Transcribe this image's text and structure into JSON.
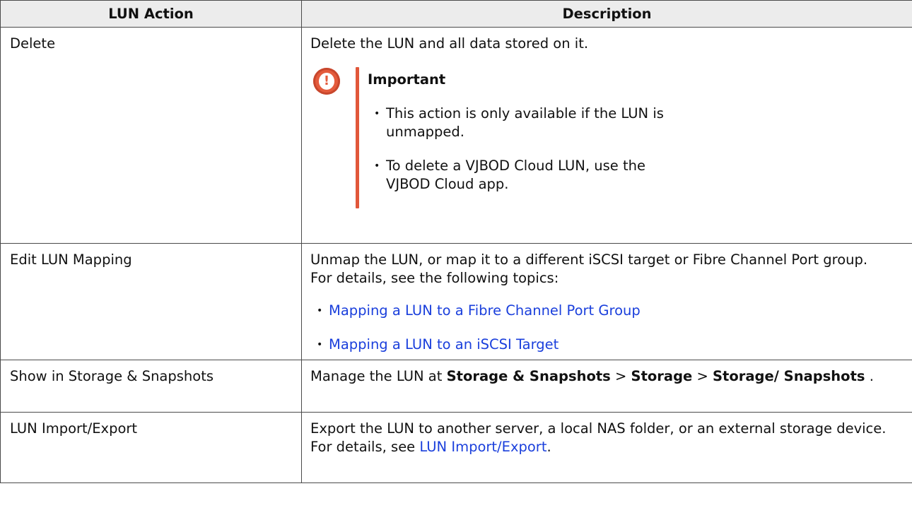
{
  "table": {
    "header": {
      "action": "LUN Action",
      "description": "Description"
    },
    "rows": [
      {
        "action": "Delete",
        "description": "Delete the LUN and all data stored on it.",
        "note": {
          "title": "Important",
          "icon": "alert-icon",
          "icon_glyph": "!",
          "color": "#e45b3c",
          "items": [
            "This action is only available if the LUN is unmapped.",
            "To delete a VJBOD Cloud LUN, use the VJBOD Cloud app."
          ]
        }
      },
      {
        "action": "Edit LUN Mapping",
        "line1": "Unmap the LUN, or map it to a different iSCSI target or Fibre Channel Port group.",
        "line2": "For details, see the following topics:",
        "links": [
          "Mapping a LUN to a Fibre Channel Port Group",
          "Mapping a LUN to an iSCSI Target"
        ]
      },
      {
        "action": "Show in Storage & Snapshots",
        "desc_prefix": "Manage the LUN at ",
        "path1": "Storage & Snapshots",
        "sep1": " > ",
        "path2": "Storage",
        "sep2": " > ",
        "path3": "Storage/ Snapshots",
        "suffix": " ."
      },
      {
        "action": "LUN Import/Export",
        "line1": "Export the LUN to another server, a local NAS folder, or an external storage device.",
        "details_prefix": "For details, see ",
        "link": "LUN Import/Export",
        "details_suffix": "."
      }
    ]
  },
  "colors": {
    "link": "#1a3fdc",
    "header_bg": "#ececec",
    "note_accent": "#e1573a"
  }
}
